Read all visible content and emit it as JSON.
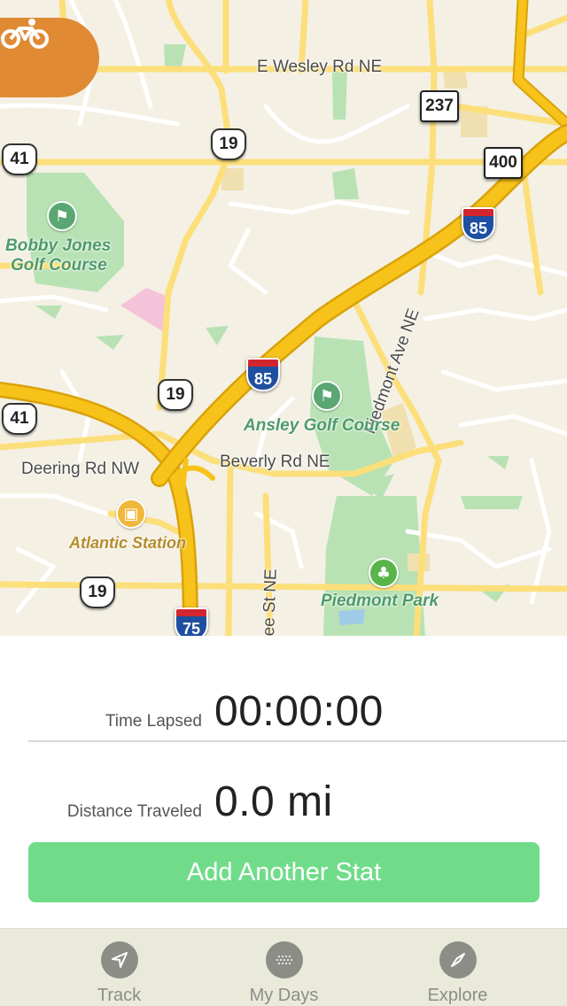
{
  "map": {
    "streets": {
      "wesley": "E Wesley Rd NE",
      "deering": "Deering Rd NW",
      "beverly": "Beverly Rd NE",
      "piedmont": "Piedmont Ave NE",
      "peachtree": "ee St NE"
    },
    "parks": {
      "bobby_jones_line1": "Bobby Jones",
      "bobby_jones_line2": "Golf Course",
      "ansley": "Ansley Golf Course",
      "piedmont_park": "Piedmont Park"
    },
    "pois": {
      "atlantic_station": "Atlantic Station"
    },
    "shields": {
      "us41_a": "41",
      "us41_b": "41",
      "us19_a": "19",
      "us19_b": "19",
      "us19_c": "19",
      "sr237": "237",
      "sr400": "400",
      "i85_a": "85",
      "i85_b": "85",
      "i75": "75"
    },
    "colors": {
      "land": "#f4f0e4",
      "highway": "#f7c31a",
      "road": "#fcdf7a",
      "park": "#b8e2b4",
      "accent": "#e08a34"
    }
  },
  "stats": {
    "time_label": "Time Lapsed",
    "time_value": "00:00:00",
    "distance_label": "Distance Traveled",
    "distance_value": "0.0 mi"
  },
  "actions": {
    "add_stat_label": "Add Another Stat",
    "add_stat_color": "#70dc8a"
  },
  "tabs": [
    {
      "label": "Track",
      "icon": "location-arrow-icon"
    },
    {
      "label": "My Days",
      "icon": "dotted-circle-icon"
    },
    {
      "label": "Explore",
      "icon": "compass-icon"
    }
  ]
}
